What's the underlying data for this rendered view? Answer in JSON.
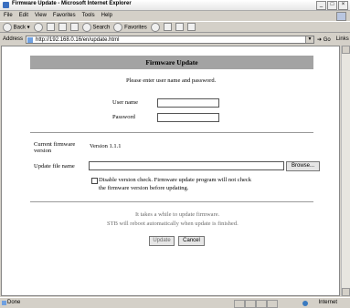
{
  "browser": {
    "window_title": "Firmware Update - Microsoft Internet Explorer",
    "menu": [
      "File",
      "Edit",
      "View",
      "Favorites",
      "Tools",
      "Help"
    ],
    "toolbar": {
      "back": "Back",
      "search": "Search",
      "favorites": "Favorites"
    },
    "address_label": "Address",
    "url": "http://192.168.0.16/en/update.html",
    "go": "Go",
    "links": "Links",
    "status": "Done",
    "zone": "Internet"
  },
  "page": {
    "header": "Firmware Update",
    "prompt": "Please enter user name and password.",
    "username_label": "User name",
    "username_value": "",
    "password_label": "Password",
    "password_value": "",
    "current_fw_label_1": "Current firmware",
    "current_fw_label_2": "version",
    "current_fw_value": "Version 1.1.1",
    "update_file_label": "Update file name",
    "update_file_value": "",
    "browse_label": "Browse...",
    "disable_check_label_1": "Disable version check. Firmware update program will not check",
    "disable_check_label_2": "the firmware version before updating.",
    "disable_check_checked": false,
    "note_1": "It takes a while to update firmware.",
    "note_2": "STB will reboot automatically when update is finished.",
    "update_button": "Update",
    "cancel_button": "Cancel"
  }
}
